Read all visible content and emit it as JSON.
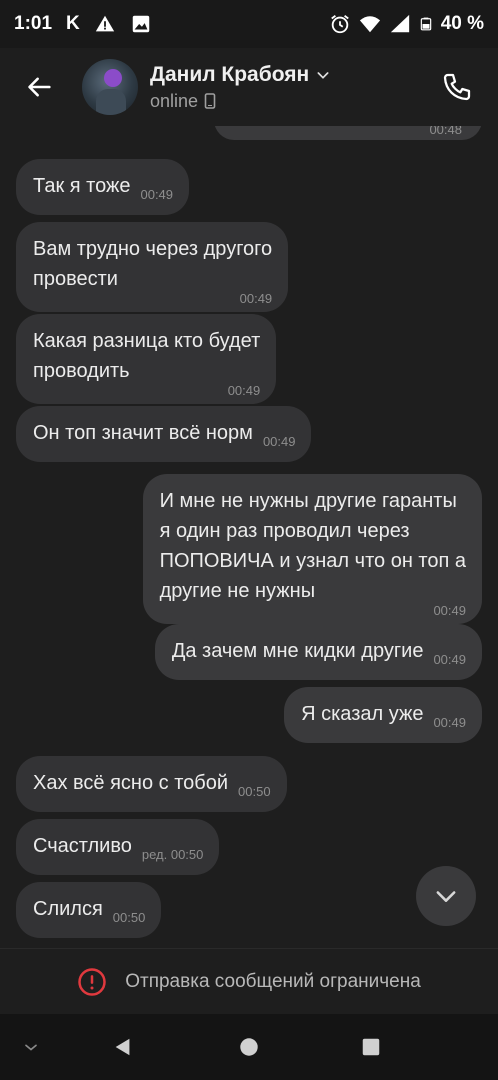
{
  "status_bar": {
    "time": "1:01",
    "carrier_letter": "K",
    "battery": "40 %"
  },
  "header": {
    "contact_name": "Данил Крабоян",
    "contact_status": "online"
  },
  "messages": [
    {
      "dir": "in",
      "text": "Так я тоже",
      "time": "00:49"
    },
    {
      "dir": "in",
      "text": "Вам трудно через другого\nпровести",
      "time": "00:49"
    },
    {
      "dir": "in",
      "text": "Какая разница кто будет\nпроводить",
      "time": "00:49"
    },
    {
      "dir": "in",
      "text": "Он топ значит всё норм",
      "time": "00:49"
    },
    {
      "dir": "out",
      "text": "И мне не нужны другие гаранты\nя один раз проводил через\nПОПОВИЧА и узнал что он топ а\nдругие не нужны",
      "time": "00:49"
    },
    {
      "dir": "out",
      "text": "Да зачем мне кидки другие",
      "time": "00:49"
    },
    {
      "dir": "out",
      "text": "Я сказал уже",
      "time": "00:49"
    },
    {
      "dir": "in",
      "text": "Хах всё ясно с тобой",
      "time": "00:50"
    },
    {
      "dir": "in",
      "text": "Счастливо",
      "time": "ред. 00:50"
    },
    {
      "dir": "in",
      "text": "Слился",
      "time": "00:50"
    }
  ],
  "partial_message_time": "00:48",
  "restriction": {
    "text": "Отправка сообщений ограничена"
  },
  "colors": {
    "background": "#1e1e1e",
    "bubble": "#333335",
    "warning_red": "#e0393e"
  },
  "icons": [
    "back-arrow-icon",
    "chevron-down-icon",
    "phone-icon",
    "mobile-device-icon",
    "chevron-down-scroll-icon",
    "warning-icon",
    "nav-back-icon",
    "nav-home-icon",
    "nav-recents-icon"
  ]
}
